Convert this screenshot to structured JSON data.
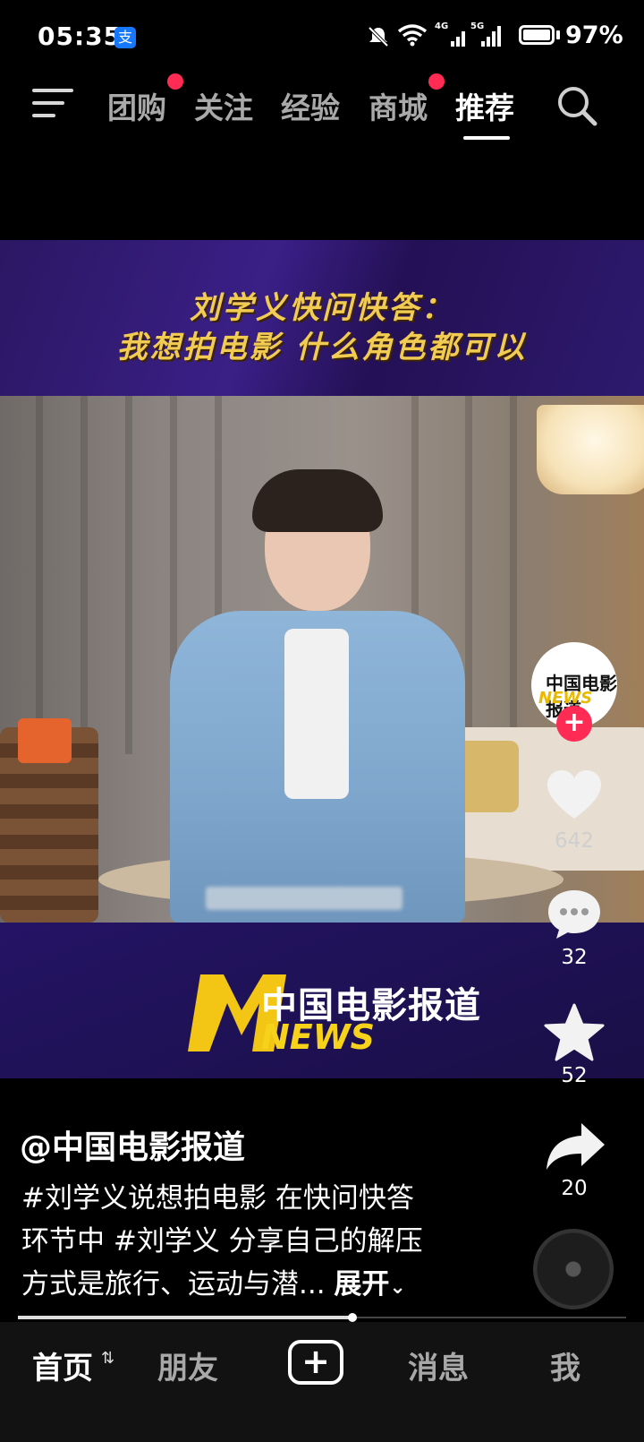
{
  "status_bar": {
    "time": "05:35",
    "pay_icon": "支",
    "net1": "4G",
    "net2": "5G",
    "battery": "97%"
  },
  "top_nav": {
    "tabs": [
      {
        "label": "团购",
        "dot": true
      },
      {
        "label": "关注",
        "dot": false
      },
      {
        "label": "经验",
        "dot": false
      },
      {
        "label": "商城",
        "dot": true
      },
      {
        "label": "推荐",
        "dot": false,
        "active": true
      }
    ]
  },
  "video": {
    "headline_line1": "刘学义快问快答：",
    "headline_line2": "我想拍电影  什么角色都可以",
    "logo_text": "中国电影报道",
    "logo_news": "NEWS",
    "avatar_text": "中国电影报道",
    "avatar_news": "NEWS"
  },
  "rail": {
    "likes": "642",
    "comments": "32",
    "favorites": "52",
    "shares": "20"
  },
  "caption": {
    "author": "@中国电影报道",
    "line1": "#刘学义说想拍电影 在快问快答",
    "line2": "环节中 #刘学义 分享自己的解压",
    "line3": "方式是旅行、运动与潜...",
    "expand": "展开"
  },
  "progress": 0.55,
  "bottom_nav": {
    "home": "首页",
    "friends": "朋友",
    "add": "+",
    "messages": "消息",
    "me": "我"
  },
  "colors": {
    "accent_red": "#fe2c55",
    "headline_gold": "#f2cb53",
    "news_yellow": "#f7d21a"
  }
}
